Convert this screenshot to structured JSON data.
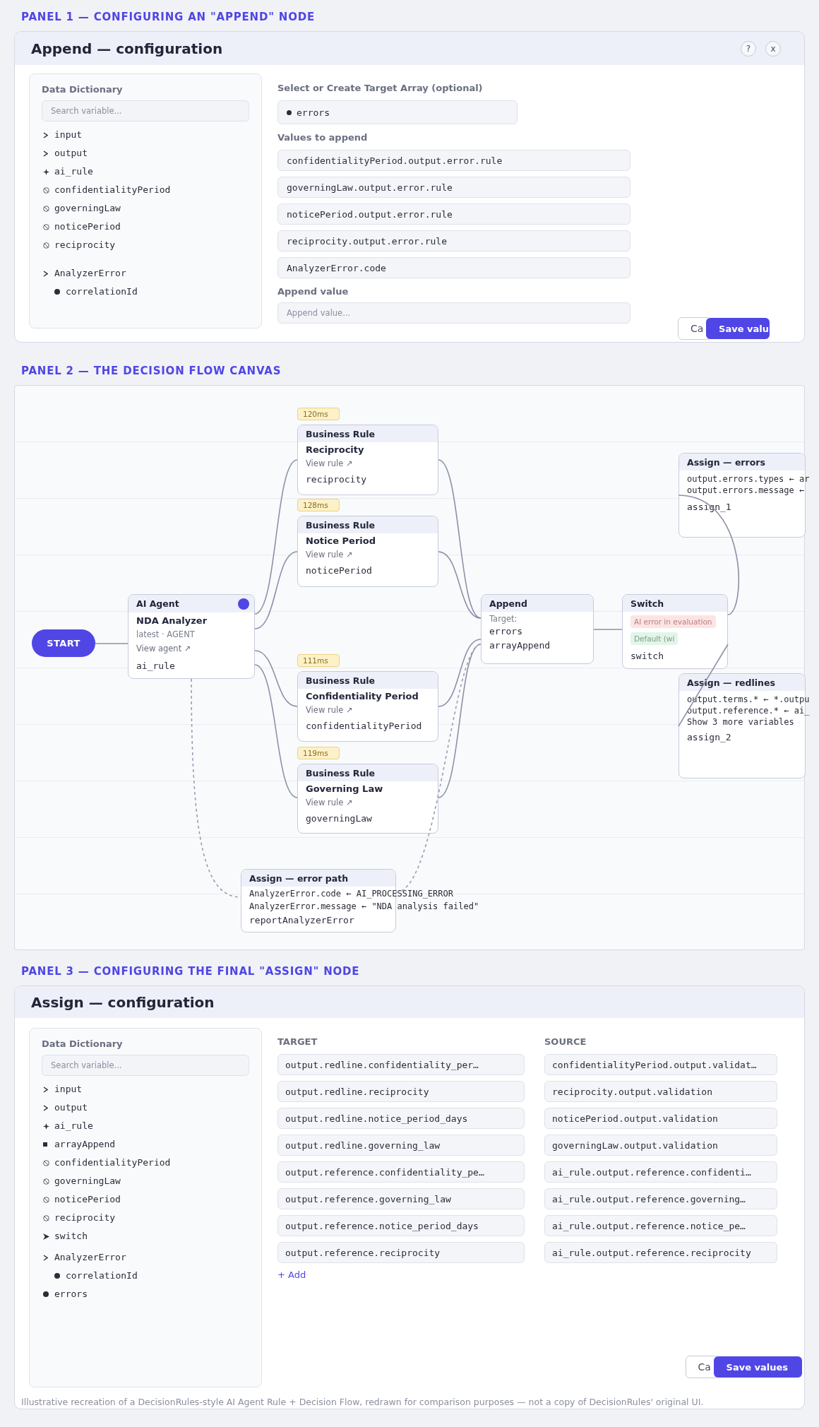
{
  "panel_1": {
    "heading": "PANEL 1 — CONFIGURING AN \"APPEND\" NODE",
    "title": "Append — configuration",
    "header_buttons": {
      "help": "?",
      "close": "x"
    },
    "dictionary": {
      "title": "Data Dictionary",
      "search_placeholder": "Search variable...",
      "items": [
        {
          "label": "input",
          "kind": "group"
        },
        {
          "label": "output",
          "kind": "group"
        },
        {
          "label": "ai_rule",
          "kind": "agent"
        },
        {
          "label": "confidentialityPeriod",
          "kind": "rule"
        },
        {
          "label": "governingLaw",
          "kind": "rule"
        },
        {
          "label": "noticePeriod",
          "kind": "rule"
        },
        {
          "label": "reciprocity",
          "kind": "rule"
        },
        {
          "label": "AnalyzerError",
          "kind": "group",
          "children": [
            {
              "label": "correlationId",
              "kind": "field"
            }
          ]
        }
      ]
    },
    "target_array": {
      "label": "Select or Create Target Array (optional)",
      "value": "errors"
    },
    "values_to_append": {
      "label": "Values to append",
      "values": [
        "confidentialityPeriod.output.error.rule",
        "governingLaw.output.error.rule",
        "noticePeriod.output.error.rule",
        "reciprocity.output.error.rule",
        "AnalyzerError.code"
      ]
    },
    "append_value": {
      "label": "Append value",
      "placeholder": "Append value..."
    },
    "actions": {
      "cancel": "Ca",
      "save": "Save valu"
    }
  },
  "panel_2": {
    "heading": "PANEL 2 — THE DECISION FLOW CANVAS",
    "start": "START",
    "nodes": [
      {
        "kind": "agent",
        "header": "AI Agent",
        "title": "NDA Analyzer",
        "meta": "latest · AGENT",
        "link": "View agent ↗",
        "variable": "ai_rule"
      },
      {
        "kind": "rule",
        "timing": "120ms",
        "header": "Business Rule",
        "title": "Reciprocity",
        "link": "View rule ↗",
        "variable": "reciprocity"
      },
      {
        "kind": "rule",
        "timing": "128ms",
        "header": "Business Rule",
        "title": "Notice Period",
        "link": "View rule ↗",
        "variable": "noticePeriod"
      },
      {
        "kind": "rule",
        "timing": "111ms",
        "header": "Business Rule",
        "title": "Confidentiality Period",
        "link": "View rule ↗",
        "variable": "confidentialityPeriod"
      },
      {
        "kind": "rule",
        "timing": "119ms",
        "header": "Business Rule",
        "title": "Governing Law",
        "link": "View rule ↗",
        "variable": "governingLaw"
      },
      {
        "kind": "append",
        "header": "Append",
        "target_label": "Target:",
        "target": "errors",
        "variable": "arrayAppend"
      },
      {
        "kind": "switch",
        "header": "Switch",
        "cases": [
          {
            "label": "AI error in evaluation",
            "kind": "error"
          },
          {
            "label": "Default (wi",
            "kind": "default"
          }
        ],
        "variable": "switch"
      },
      {
        "kind": "assign",
        "header": "Assign — errors",
        "assignments": [
          "output.errors.types ← ar",
          "output.errors.message ←"
        ],
        "variable": "assign_1"
      },
      {
        "kind": "assign",
        "header": "Assign — redlines",
        "assignments": [
          "output.terms.* ← *.outpu",
          "output.reference.* ← ai_"
        ],
        "more": "Show 3 more variables",
        "variable": "assign_2"
      },
      {
        "kind": "assign",
        "header": "Assign — error path",
        "assignments": [
          "AnalyzerError.code ← AI_PROCESSING_ERROR",
          "AnalyzerError.message ← \"NDA analysis failed\""
        ],
        "variable": "reportAnalyzerError"
      }
    ]
  },
  "panel_3": {
    "heading": "PANEL 3 — CONFIGURING THE FINAL \"ASSIGN\" NODE",
    "title": "Assign — configuration",
    "dictionary": {
      "title": "Data Dictionary",
      "search_placeholder": "Search variable...",
      "items": [
        {
          "label": "input",
          "kind": "group"
        },
        {
          "label": "output",
          "kind": "group"
        },
        {
          "label": "ai_rule",
          "kind": "agent"
        },
        {
          "label": "arrayAppend",
          "kind": "array"
        },
        {
          "label": "confidentialityPeriod",
          "kind": "rule"
        },
        {
          "label": "governingLaw",
          "kind": "rule"
        },
        {
          "label": "noticePeriod",
          "kind": "rule"
        },
        {
          "label": "reciprocity",
          "kind": "rule"
        },
        {
          "label": "switch",
          "kind": "switch"
        },
        {
          "label": "AnalyzerError",
          "kind": "group",
          "children": [
            {
              "label": "correlationId",
              "kind": "field"
            }
          ]
        },
        {
          "label": "errors",
          "kind": "field"
        }
      ]
    },
    "columns": [
      "TARGET",
      "SOURCE"
    ],
    "rows": [
      {
        "target": "output.redline.confidentiality_per…",
        "source": "confidentialityPeriod.output.validat…"
      },
      {
        "target": "output.redline.reciprocity",
        "source": "reciprocity.output.validation"
      },
      {
        "target": "output.redline.notice_period_days",
        "source": "noticePeriod.output.validation"
      },
      {
        "target": "output.redline.governing_law",
        "source": "governingLaw.output.validation"
      },
      {
        "target": "output.reference.confidentiality_pe…",
        "source": "ai_rule.output.reference.confidenti…"
      },
      {
        "target": "output.reference.governing_law",
        "source": "ai_rule.output.reference.governing…"
      },
      {
        "target": "output.reference.notice_period_days",
        "source": "ai_rule.output.reference.notice_pe…"
      },
      {
        "target": "output.reference.reciprocity",
        "source": "ai_rule.output.reference.reciprocity"
      }
    ],
    "add_link": "+ Add",
    "actions": {
      "cancel": "Ca",
      "save": "Save values"
    },
    "footnote": "Illustrative recreation of a DecisionRules-style AI Agent Rule + Decision Flow, redrawn for comparison purposes — not a copy of DecisionRules' original UI."
  }
}
